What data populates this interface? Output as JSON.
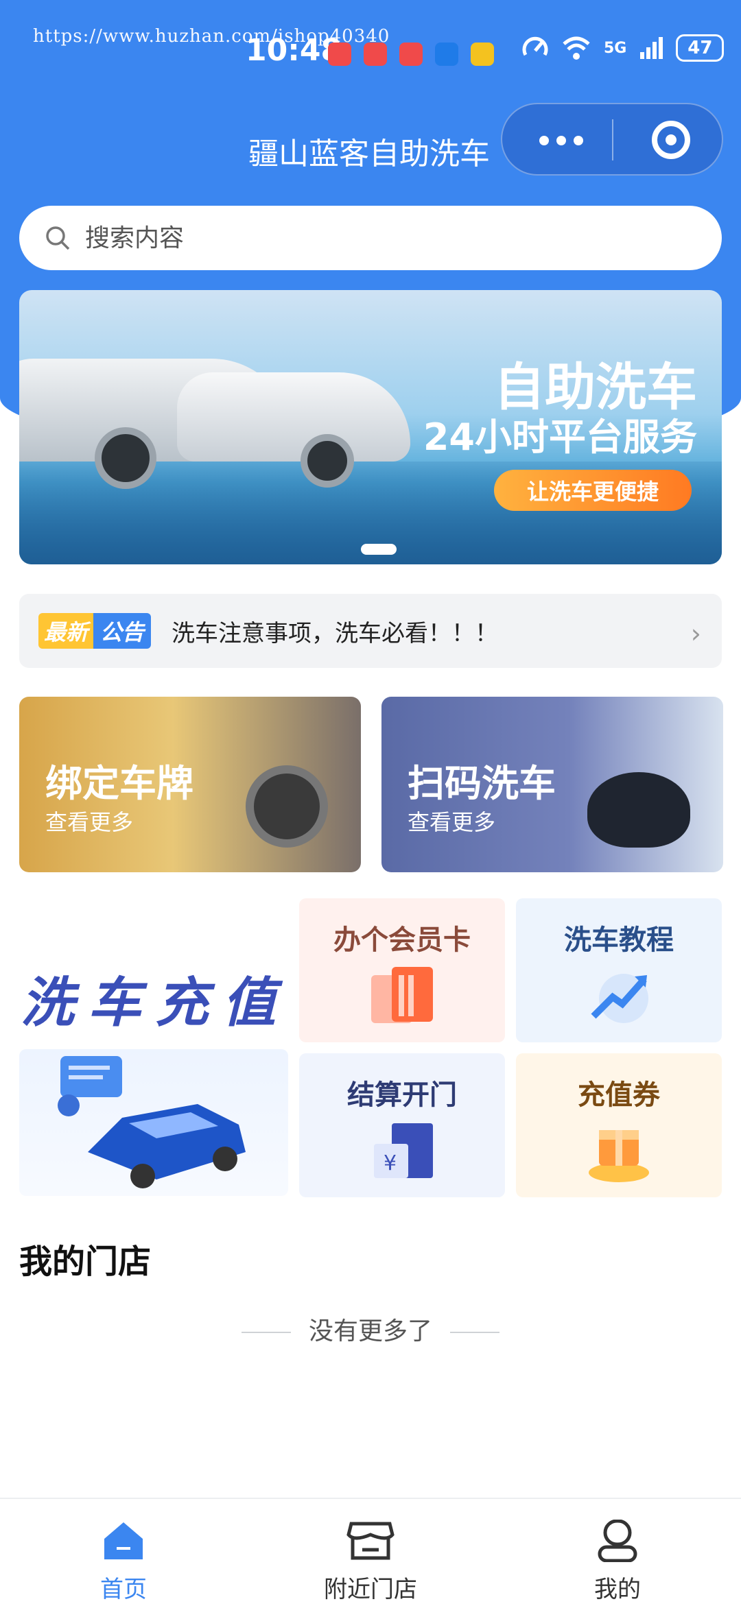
{
  "watermark": "https://www.huzhan.com/ishop40340",
  "status_bar": {
    "time": "10:48",
    "signal": "5G",
    "battery": "47"
  },
  "header": {
    "title": "疆山蓝客自助洗车",
    "capsule_more_icon": "more-dots-icon",
    "capsule_close_icon": "target-circle-icon"
  },
  "search": {
    "placeholder": "搜索内容"
  },
  "banner": {
    "title": "自助洗车",
    "subtitle": "24小时平台服务",
    "button": "让洗车更便捷"
  },
  "notice": {
    "badge_left": "最新",
    "badge_right": "公告",
    "text": "洗车注意事项，洗车必看！！！"
  },
  "cards": [
    {
      "title": "绑定车牌",
      "subtitle": "查看更多"
    },
    {
      "title": "扫码洗车",
      "subtitle": "查看更多"
    }
  ],
  "recharge": {
    "title": "洗车充值"
  },
  "tiles": [
    {
      "label": "办个会员卡",
      "color": "#8a4a3a"
    },
    {
      "label": "洗车教程",
      "color": "#2a4f8a"
    },
    {
      "label": "结算开门",
      "color": "#2e3b74"
    },
    {
      "label": "充值券",
      "color": "#7a4a12"
    }
  ],
  "stores": {
    "title": "我的门店",
    "empty": "没有更多了"
  },
  "tabbar": {
    "items": [
      {
        "label": "首页",
        "icon": "home-icon",
        "active": true
      },
      {
        "label": "附近门店",
        "icon": "store-icon",
        "active": false
      },
      {
        "label": "我的",
        "icon": "user-icon",
        "active": false
      }
    ]
  },
  "colors": {
    "primary": "#3b86f0",
    "accent": "#ff8a2a"
  }
}
